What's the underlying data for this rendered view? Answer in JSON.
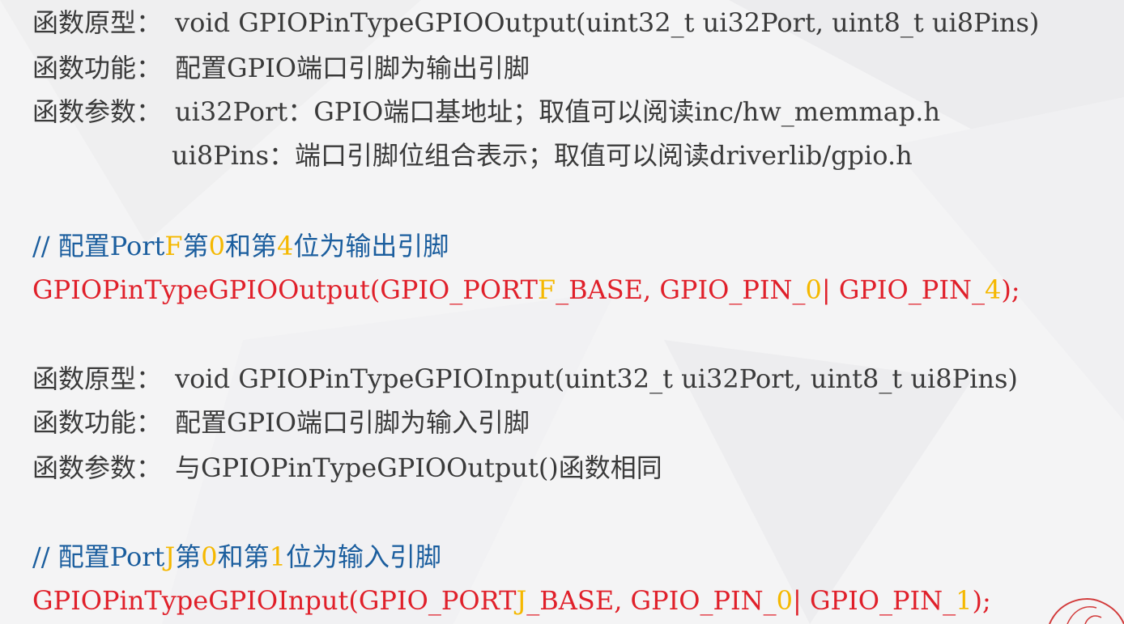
{
  "block1": {
    "proto_key": "函数原型：",
    "proto_val": "void GPIOPinTypeGPIOOutput(uint32_t ui32Port, uint8_t ui8Pins)",
    "func_key": "函数功能：",
    "func_val": "配置GPIO端口引脚为输出引脚",
    "param_key": "函数参数：",
    "param1": "ui32Port：GPIO端口基地址；取值可以阅读inc/hw_memmap.h",
    "param2": "ui8Pins：端口引脚位组合表示；取值可以阅读driverlib/gpio.h"
  },
  "comment1": {
    "p1": "//  配置Port",
    "h1": "F",
    "p2": "第",
    "h2": "0",
    "p3": "和第",
    "h3": "4",
    "p4": "位为输出引脚"
  },
  "code1": {
    "p1": "GPIOPinTypeGPIOOutput(GPIO_PORT",
    "h1": "F",
    "p2": "_BASE, GPIO_PIN_",
    "h2": "0",
    "p3": "| GPIO_PIN_",
    "h3": "4",
    "p4": ");"
  },
  "block2": {
    "proto_key": "函数原型：",
    "proto_val": "void GPIOPinTypeGPIOInput(uint32_t ui32Port, uint8_t ui8Pins)",
    "func_key": "函数功能：",
    "func_val": "配置GPIO端口引脚为输入引脚",
    "param_key": "函数参数：",
    "param_val": "与GPIOPinTypeGPIOOutput()函数相同"
  },
  "comment2": {
    "p1": "//  配置Port",
    "h1": "J",
    "p2": "第",
    "h2": "0",
    "p3": "和第",
    "h3": "1",
    "p4": "位为输入引脚"
  },
  "code2": {
    "p1": "GPIOPinTypeGPIOInput(GPIO_PORT",
    "h1": "J",
    "p2": "_BASE, GPIO_PIN_",
    "h2": "0",
    "p3": "| GPIO_PIN_",
    "h3": "1",
    "p4": ");"
  },
  "colors": {
    "text": "#3a3a3a",
    "comment": "#1b5e9e",
    "code": "#e0202a",
    "highlight": "#f5b800"
  }
}
